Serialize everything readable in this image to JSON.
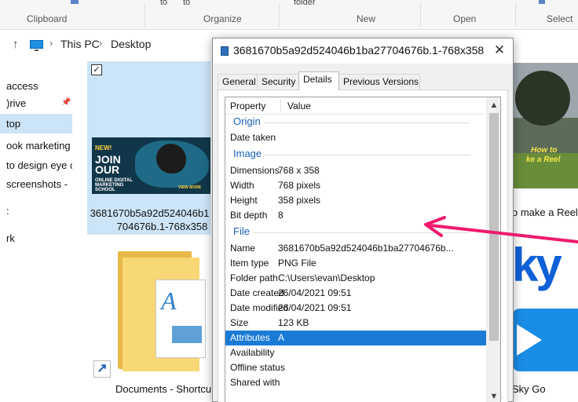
{
  "ribbon": {
    "fragments": [
      "to",
      "to",
      "folder"
    ],
    "groups": {
      "clipboard": "Clipboard",
      "organize": "Organize",
      "new": "New",
      "open": "Open",
      "select": "Select"
    }
  },
  "address_bar": {
    "up_glyph": "↑",
    "chevron": "›",
    "crumbs": [
      "This PC",
      "Desktop"
    ]
  },
  "nav_pane": {
    "items": [
      "access",
      ")rive",
      "top",
      "ook marketing",
      "to design eye c",
      "screenshots -",
      ":",
      "rk"
    ],
    "pin_glyph": "📌"
  },
  "files": {
    "selected_checkbox_glyph": "✓",
    "image_file": {
      "name_line1": "3681670b5a92d524046b1",
      "name_line2": "704676b.1-768x358",
      "thumb_text": {
        "new": "NEW!",
        "big": "JOIN OUR",
        "small": "ONLINE DIGITAL MARKETING SCHOOL",
        "cta": "VIEW MORE"
      }
    },
    "documents_shortcut": {
      "label": "Documents - Shortcu",
      "shortcut_glyph": "↗",
      "paper_letter": "A"
    },
    "reel_file": {
      "label": "o make a Reel",
      "thumb_line1": "How to",
      "thumb_line2": "ke a Reel"
    },
    "sky_logo": "ky",
    "sky_go": {
      "label": "Sky Go"
    }
  },
  "dialog": {
    "title": "3681670b5a92d524046b1ba27704676b.1-768x358 Pr...",
    "close_glyph": "✕",
    "tabs": [
      "General",
      "Security",
      "Details",
      "Previous Versions"
    ],
    "active_tab": "Details",
    "columns": {
      "property": "Property",
      "value": "Value"
    },
    "sections": {
      "origin": "Origin",
      "image": "Image",
      "file": "File"
    },
    "origin_rows": [
      {
        "property": "Date taken",
        "value": ""
      }
    ],
    "image_rows": [
      {
        "property": "Dimensions",
        "value": "768 x 358"
      },
      {
        "property": "Width",
        "value": "768 pixels"
      },
      {
        "property": "Height",
        "value": "358 pixels"
      },
      {
        "property": "Bit depth",
        "value": "8"
      }
    ],
    "file_rows": [
      {
        "property": "Name",
        "value": "3681670b5a92d524046b1ba27704676b..."
      },
      {
        "property": "Item type",
        "value": "PNG File"
      },
      {
        "property": "Folder path",
        "value": "C:\\Users\\evan\\Desktop"
      },
      {
        "property": "Date created",
        "value": "26/04/2021 09:51"
      },
      {
        "property": "Date modified",
        "value": "26/04/2021 09:51"
      },
      {
        "property": "Size",
        "value": "123 KB"
      },
      {
        "property": "Attributes",
        "value": "A"
      },
      {
        "property": "Availability",
        "value": ""
      },
      {
        "property": "Offline status",
        "value": ""
      },
      {
        "property": "Shared with",
        "value": ""
      }
    ],
    "selected_row": "Attributes",
    "scroll": {
      "up_glyph": "▲",
      "down_glyph": "▼"
    }
  },
  "colors": {
    "annotation_arrow": "#ee1a6e",
    "selection_blue": "#1a7bd6",
    "section_blue": "#1a5fb4"
  }
}
